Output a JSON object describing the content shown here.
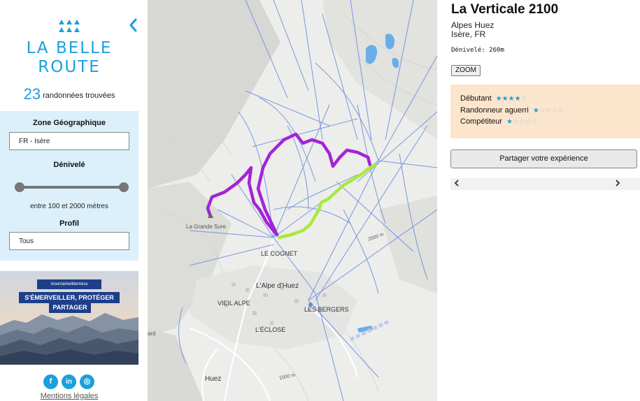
{
  "sidebar": {
    "brand_line1": "LA BELLE",
    "brand_line2": "ROUTE",
    "result_count": "23",
    "result_text": "randonnées trouvées",
    "zone_label": "Zone Géographique",
    "zone_value": "FR - Isère",
    "elevation_label": "Dénivelé",
    "elevation_range_text": "entre 100 et 2000 mètres",
    "elevation_range_min": 100,
    "elevation_range_max": 2000,
    "profile_label": "Profil",
    "profile_value": "Tous",
    "banner": {
      "logo_text": "mountainwilderness",
      "slogan": "S'ÉMERVEILLER, PROTÉGER",
      "share": "PARTAGER"
    },
    "socials": [
      {
        "name": "facebook-icon",
        "glyph": "f"
      },
      {
        "name": "linkedin-icon",
        "glyph": "in"
      },
      {
        "name": "instagram-icon",
        "glyph": "◎"
      }
    ],
    "legal_link": "Mentions légales"
  },
  "map": {
    "labels": {
      "grande_sure": "La Grande Sure",
      "cognet": "LE COGNET",
      "alpe_dhuez": "L'Alpe d'Huez",
      "vieil_alpe": "VIEIL ALPE",
      "les_bergers": "LES BERGERS",
      "eclose": "L'ÉCLOSE",
      "huez": "Huez",
      "contour_2000": "2000 m",
      "contour_1500": "1500 m",
      "ard": "ard"
    },
    "colors": {
      "route_purple": "#a323d8",
      "route_green": "#a6ea3a",
      "piste_blue": "#6b8fe0",
      "lake_blue": "#6aaee8"
    }
  },
  "panel": {
    "title": "La Verticale 2100",
    "location_line1": "Alpes Huez",
    "location_line2": "Isère, FR",
    "elevation_text": "Dénivelé: 260m",
    "zoom_label": "ZOOM",
    "levels": [
      {
        "label": "Débutant",
        "rating": 4,
        "max": 5
      },
      {
        "label": "Randonneur aguerri",
        "rating": 1,
        "max": 5
      },
      {
        "label": "Compétiteur",
        "rating": 1,
        "max": 5
      }
    ],
    "share_button": "Partager votre expérience",
    "scroll_left": "‹",
    "scroll_right": "›"
  }
}
